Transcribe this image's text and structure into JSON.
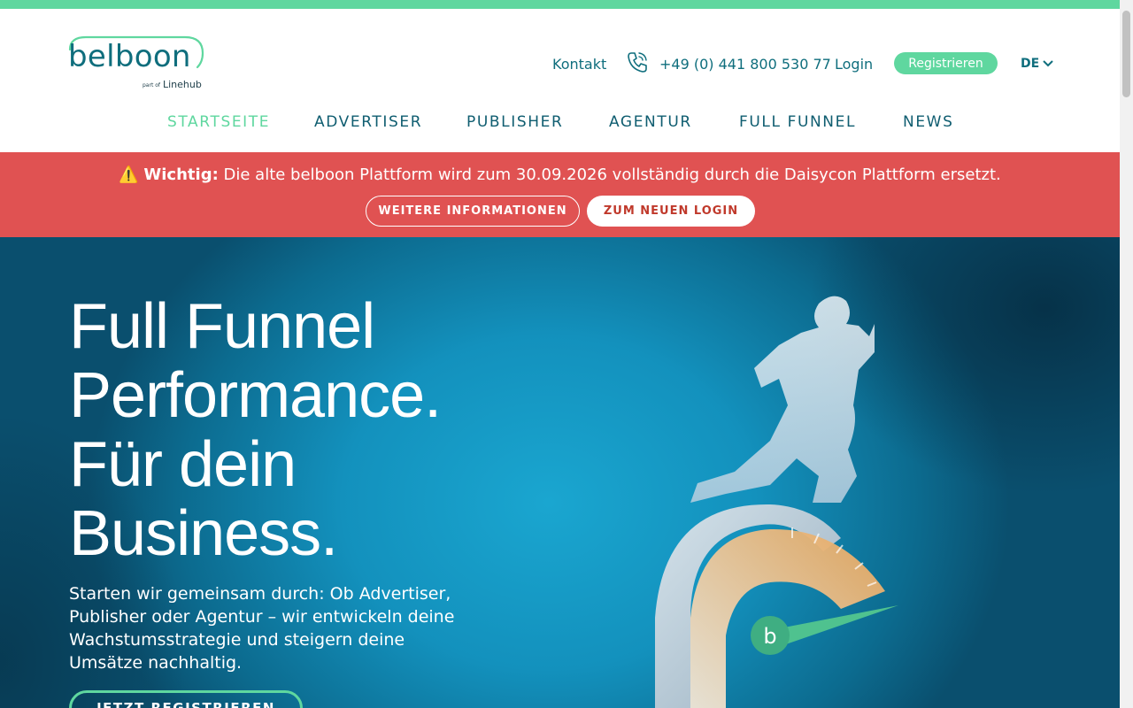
{
  "header": {
    "logo": {
      "word": "belboon",
      "sub_small": "part of",
      "sub_brand": "Linehub"
    },
    "utility": {
      "contact_label": "Kontakt",
      "phone_icon": "phone-icon",
      "phone_number": "+49 (0) 441 800 530 77",
      "login_label": "Login",
      "register_label": "Registrieren",
      "language_label": "DE"
    },
    "nav": [
      {
        "label": "STARTSEITE",
        "active": true
      },
      {
        "label": "ADVERTISER",
        "active": false
      },
      {
        "label": "PUBLISHER",
        "active": false
      },
      {
        "label": "AGENTUR",
        "active": false
      },
      {
        "label": "FULL FUNNEL",
        "active": false
      },
      {
        "label": "NEWS",
        "active": false
      }
    ]
  },
  "alert": {
    "icon": "warning-icon",
    "emoji": "⚠️",
    "strong": "Wichtig:",
    "message": " Die alte belboon Plattform wird zum 30.09.2026 vollständig durch die Daisycon Plattform ersetzt.",
    "button_info": "WEITERE INFORMATIONEN",
    "button_login": "ZUM NEUEN LOGIN"
  },
  "hero": {
    "title_lines": [
      "Full Funnel",
      "Performance.",
      "Für dein",
      "Business."
    ],
    "copy": "Starten wir gemeinsam durch: Ob Advertiser, Publisher oder Agentur – wir entwickeln deine Wachstumsstrategie und steigern deine Umsätze nachhaltig.",
    "cta_label": "JETZT REGISTRIEREN",
    "art_logo_letter": "b"
  },
  "colors": {
    "accent_green": "#5fd79f",
    "brand_teal": "#0f6e7d",
    "alert_red": "#e05252",
    "hero_blue": "#1391bd"
  }
}
